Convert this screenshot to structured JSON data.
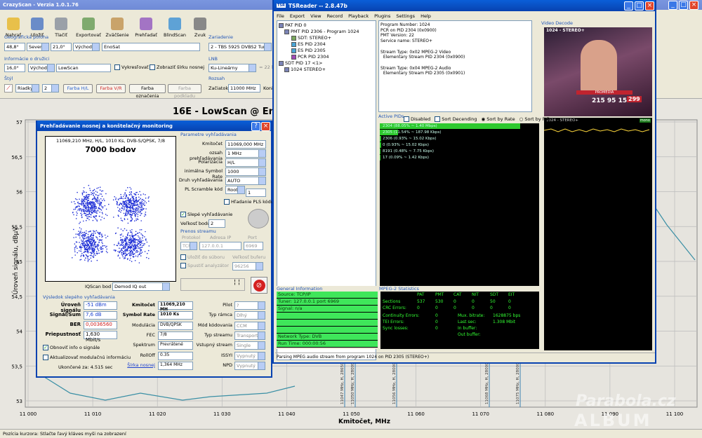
{
  "crazyscan": {
    "title": "CrazyScan - Verzia 1.0.1.76",
    "toolbar": [
      "Nahrať",
      "Uložiť",
      "Tlačiť",
      "Exportovať",
      "Zväčšenie",
      "Prehľadať",
      "BlindScan",
      "Zvuk"
    ],
    "geo_label": "Geografická poloha",
    "geo_lat": "48,8°",
    "geo_ns": "Sever",
    "geo_lon": "21,0°",
    "geo_ew": "Východ",
    "geo_site": "EnoSat",
    "sat_label": "Informácie o družici",
    "sat_pos": "16,0°",
    "sat_ew": "Východ",
    "sat_name": "LowScan",
    "chk_draw": "Vykresľovať",
    "chk_width": "Zobraziť šírku nosnej",
    "style_label": "Štýl",
    "style_rows": "Riadky",
    "style_num": "2",
    "btn_hv": "Farba H/L",
    "btn_vr": "Farba V/R",
    "btn_mark": "Farba označenia",
    "btn_under": "Farba podkladu",
    "device_label": "Zariadenie",
    "device": "2 - TBS 5925 DVBS2 Tuner",
    "lnb_label": "LNB",
    "lnb": "Ku-Lineárny",
    "lnb_val": "= 22 kHz",
    "range_label": "Rozsah",
    "range_start_label": "Začiatok",
    "range_start": "11000 MHz",
    "range_end_label": "Koniec",
    "status": "Pozícia kurzora: Stlačte ľavý kláves myši na zobrazení"
  },
  "chart": {
    "title": "16E - LowScan @ EnoSat",
    "ylabel": "Úroveň signálu, dBµV",
    "xlabel": "Kmitočet, MHz",
    "xticks": [
      "11 000",
      "11 010",
      "11 020",
      "11 030",
      "11 040",
      "11 050",
      "11 060",
      "11 070",
      "11 080",
      "11 090",
      "11 100"
    ],
    "yticks": [
      "57",
      "56,5",
      "56",
      "55,5",
      "55",
      "54,5",
      "54",
      "53,5",
      "53"
    ],
    "markers": [
      "11047 MHz, H, 28650",
      "11050 MHz, H, 28000",
      "11056 MHz, H, 28000",
      "11068 MHz, H, 28000",
      "11075 MHz, H, 28000"
    ]
  },
  "dialog": {
    "title": "Prehľadávanie nosnej a konštelačný monitoring",
    "constellation_info": "11069,210 MHz, H/L, 1010 Ks, DVB-S/QPSK, 7/8",
    "constellation_count": "7000 bodov",
    "iqscan_label": "IQScan bod",
    "iqscan": "Demod IQ out",
    "params_label": "Parametre vyhľadávania",
    "params": [
      [
        "Kmitočet",
        "11069,000 MHz"
      ],
      [
        "ozsah prehľadávania",
        "1 MHz"
      ],
      [
        "Polarizácia",
        "H/L"
      ],
      [
        "inimálna Symbol Rate",
        "1000"
      ],
      [
        "Druh vyhľadávania",
        "AUTO"
      ],
      [
        "PL Scramble kód",
        "Root"
      ]
    ],
    "pl_num": "1",
    "pls_chk": "Hľadanie PLS kódu",
    "blind_chk": "Slepé vyhľadávanie",
    "step_label": "Veľkosť bodu",
    "step": "2",
    "stream_label": "Prenos streamu",
    "stream_cols": [
      "Protokol",
      "Adresa IP",
      "Port"
    ],
    "stream_vals": [
      "TCP",
      "127.0.0.1",
      "6969"
    ],
    "save_file": "Uložiť do súboru",
    "buffer_label": "Veľkosť buferu",
    "start_analyzer": "Spustiť analyzátor",
    "buffer": "96256",
    "result_label": "Výsledok slepého vyhľadávania",
    "left": [
      [
        "Úroveň signálu",
        "-51 dBm"
      ],
      [
        "Signál/Šum",
        "7,6 dB"
      ],
      [
        "BER",
        "0,0036560"
      ],
      [
        "Priepustnosť",
        "1,630 Mbit/s"
      ]
    ],
    "mid": [
      [
        "Kmitočet",
        "11069,210 MH"
      ],
      [
        "Symbol Rate",
        "1010 Ks"
      ],
      [
        "Modulácia",
        "DVB/QPSK"
      ],
      [
        "FEC",
        "7/8"
      ],
      [
        "Spektrum",
        "Prevrátené"
      ],
      [
        "RollOff",
        "0.35"
      ],
      [
        "Šírka nosnej",
        "1,364 MHz"
      ]
    ],
    "right": [
      [
        "Pilot",
        "?"
      ],
      [
        "Typ rámca",
        "Dlhý"
      ],
      [
        "Mód kódovania",
        "CCM"
      ],
      [
        "Typ streamu",
        "Transport"
      ],
      [
        "Vstupný stream",
        "Single"
      ],
      [
        "ISSYI",
        "Vypnutý"
      ],
      [
        "NPD",
        "Vypnutý"
      ]
    ],
    "renew_chk": "Obnoviť info o signále",
    "update_chk": "Aktualizovať modulačnú informáciu",
    "finished": "Ukončené za: 4.515 sec"
  },
  "tsreader": {
    "title": "TSReader -- 2.8.47b",
    "menu": [
      "File",
      "Export",
      "View",
      "Record",
      "Playback",
      "Plugins",
      "Settings",
      "Help"
    ],
    "tree": [
      "PAT PID 0",
      "PMT PID 2306 - Program 1024",
      "SDT: STEREO+",
      "ES PID 2304",
      "ES PID 2305",
      "PCR PID 2304",
      "SDT PID 17 <1>",
      "1024 STEREO+"
    ],
    "info": [
      "Program Number: 1024",
      "PCR on PID 2304 (0x0900)",
      "PMT Version: 22",
      "Service name: STEREO+",
      "",
      "Stream Type: 0x02 MPEG-2 Video",
      "  Elementary Stream PID 2304 (0x0900)",
      "",
      "Stream Type: 0x04 MPEG-2 Audio",
      "  Elementary Stream PID 2305 (0x0901)"
    ],
    "video_label": "Video Decode",
    "video_channel": "1024 - STEREO+",
    "video_promo": "PROMEDIA",
    "video_phone": "215 95 15",
    "video_price": "299",
    "pids_label": "Active PIDs",
    "pid_opts": [
      "Disabled",
      "Sort Decending",
      "Sort by Rate",
      "Sort by PID"
    ],
    "pids": [
      "2304 (88.05% ~ 1.40 Mbps)",
      "2305 (11.54% ~ 187.98 Kbps)",
      "2306 (0.93% ~ 15.02 Kbps)",
      "0 (0.93% ~ 15.02 Kbps)",
      "8191 (0.48% ~ 7.75 Kbps)",
      "17 (0.09% ~ 1.42 Kbps)"
    ],
    "pid_shares": [
      0.8805,
      0.1154,
      0.0093,
      0.0093,
      0.0048,
      0.0009
    ],
    "gen_label": "General Information",
    "gen": [
      "Source: TCP/IP",
      "Tuner: 127.0.0.1 port 6969",
      "Signal: n/a",
      "",
      "",
      "",
      "Network Type: DVB",
      "Run Time: 000:00:56"
    ],
    "stats_label": "MPEG-2 Statistics",
    "stats_cols": [
      "PAT",
      "PMT",
      "CAT",
      "NIT",
      "SDT",
      "EIT"
    ],
    "stats_rows": [
      [
        "Sections",
        "537",
        "530",
        "0",
        "0",
        "50",
        "0"
      ],
      [
        "CRC Errors:",
        "0",
        "0",
        "0",
        "0",
        "0",
        "0"
      ]
    ],
    "stats_extra": [
      [
        "Continuity Errors:",
        "0",
        "Mux. bitrate:",
        "1628875 bps"
      ],
      [
        "TEI Errors:",
        "0",
        "Last sec:",
        "1.308 Mbit"
      ],
      [
        "Sync losses:",
        "0",
        "In buffer:",
        ""
      ],
      [
        "",
        "",
        "Out buffer:",
        ""
      ]
    ],
    "status": "Parsing MPEG audio stream from program 1024 on PID 2305 (STEREO+)",
    "mini_labels": [
      "STEREO+",
      "mono"
    ]
  },
  "watermark": {
    "line1": "Parabola.cz",
    "line2": "ALBUM"
  }
}
